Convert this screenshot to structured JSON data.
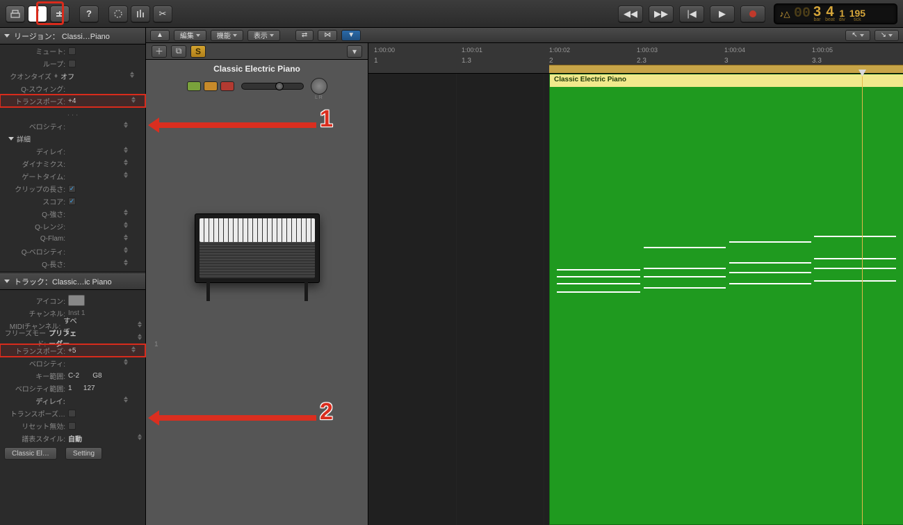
{
  "topbar": {
    "lcd": {
      "prefix": "00",
      "bar": "3",
      "beat": "4",
      "div": "1",
      "tick": "195",
      "bar_lbl": "bar",
      "beat_lbl": "beat",
      "div_lbl": "div",
      "tick_lbl": "tick"
    }
  },
  "region": {
    "header": "リージョン： Classi…Piano",
    "mute": "ミュート:",
    "loop": "ループ:",
    "quantize_lbl": "クオンタイズ",
    "quantize_off": "オフ",
    "qswing": "Q-スウィング:",
    "transpose_lbl": "トランスポーズ:",
    "transpose_val": "+4",
    "velocity": "ベロシティ:",
    "detail": "詳細",
    "delay": "ディレイ:",
    "dynamics": "ダイナミクス:",
    "gate": "ゲートタイム:",
    "clip": "クリップの長さ:",
    "score": "スコア:",
    "qstr": "Q-強さ:",
    "qrng": "Q-レンジ:",
    "qflm": "Q-Flam:",
    "qvel": "Q-ベロシティ:",
    "qlen": "Q-長さ:"
  },
  "track": {
    "header": "トラック：Classic…ic Piano",
    "icon": "アイコン:",
    "channel": "チャンネル:",
    "channel_val": "Inst 1",
    "midich": "MIDIチャンネル:",
    "midich_val": "すべて",
    "freeze": "フリーズモード:",
    "freeze_val": "プリフェーダー",
    "transpose_lbl": "トランスポーズ:",
    "transpose_val": "+5",
    "velocity": "ベロシティ:",
    "keyrange": "キー範囲:",
    "key_lo": "C-2",
    "key_hi": "G8",
    "velrange": "ベロシティ範囲:",
    "vel_lo": "1",
    "vel_hi": "127",
    "delay": "ディレイ:",
    "transset": "トランスポーズ…",
    "noreset": "リセット無効:",
    "staff": "譜表スタイル:",
    "staff_val": "自動",
    "setting_btn": "Setting",
    "classic_btn": "Classic El…"
  },
  "editor": {
    "edit": "編集",
    "func": "機能",
    "view": "表示",
    "track_name": "Classic Electric Piano",
    "row_num": "1",
    "pan_lbl": "L       R"
  },
  "ruler": {
    "times": [
      "1:00:00",
      "1:00:01",
      "1:00:02",
      "1:00:03",
      "1:00:04",
      "1:00:05"
    ],
    "bars": [
      "1",
      "1.3",
      "2",
      "2.3",
      "3",
      "3.3"
    ]
  },
  "clip": {
    "name": "Classic Electric Piano"
  },
  "annotations": {
    "one": "1",
    "two": "2"
  }
}
